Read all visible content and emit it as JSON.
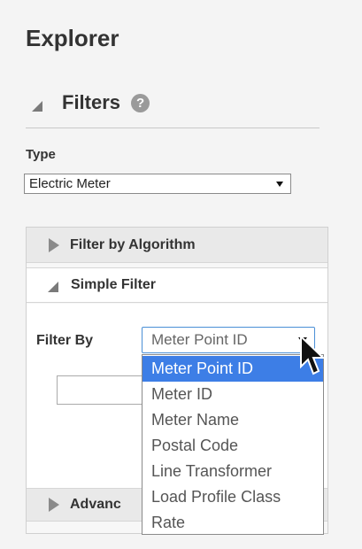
{
  "panel": {
    "title": "Explorer",
    "filters": {
      "label": "Filters",
      "help_glyph": "?"
    }
  },
  "type_field": {
    "label": "Type",
    "value": "Electric Meter"
  },
  "accordion": {
    "filter_by_algorithm": "Filter by Algorithm",
    "simple_filter": "Simple Filter",
    "advanced_partial": "Advanc"
  },
  "simple_filter": {
    "filter_by_label": "Filter By",
    "filter_by_value": "Meter Point ID",
    "text_value": "",
    "options": [
      "Meter Point ID",
      "Meter ID",
      "Meter Name",
      "Postal Code",
      "Line Transformer",
      "Load Profile Class",
      "Rate"
    ],
    "selected_index": 0
  },
  "colors": {
    "accent": "#3d7ee6",
    "focus_border": "#4a8fd6",
    "panel_bg": "#f4f4f4"
  },
  "icons": {
    "collapse": "triangle-collapse-icon",
    "expand": "triangle-right-icon",
    "help": "help-icon",
    "cursor": "mouse-pointer-icon"
  }
}
